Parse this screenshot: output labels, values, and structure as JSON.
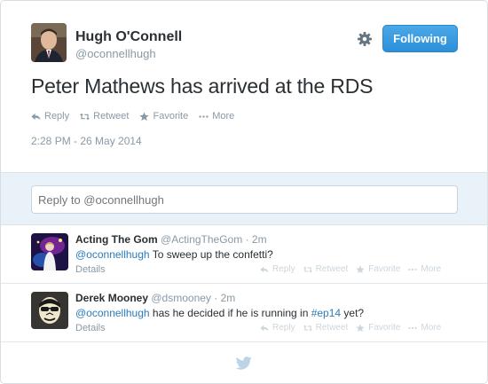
{
  "main_tweet": {
    "name": "Hugh O'Connell",
    "handle": "@oconnellhugh",
    "follow_label": "Following",
    "text": "Peter Mathews has arrived at the RDS",
    "actions": {
      "reply": "Reply",
      "retweet": "Retweet",
      "favorite": "Favorite",
      "more": "More"
    },
    "timestamp": "2:28 PM - 26 May 2014"
  },
  "reply_box": {
    "placeholder": "Reply to @oconnellhugh"
  },
  "replies": [
    {
      "name": "Acting The Gom",
      "handle": "@ActingTheGom",
      "time": "· 2m",
      "mention": "@oconnellhugh",
      "text": " To sweep up the confetti?",
      "details": "Details",
      "actions": {
        "reply": "Reply",
        "retweet": "Retweet",
        "favorite": "Favorite",
        "more": "More"
      }
    },
    {
      "name": "Derek Mooney",
      "handle": "@dsmooney",
      "time": "· 2m",
      "mention": "@oconnellhugh",
      "text_before": " has he decided if he is running in ",
      "hashtag": "#ep14",
      "text_after": " yet?",
      "details": "Details",
      "actions": {
        "reply": "Reply",
        "retweet": "Retweet",
        "favorite": "Favorite",
        "more": "More"
      }
    }
  ],
  "icons": [
    "gear-icon",
    "reply-icon",
    "retweet-icon",
    "favorite-icon",
    "more-icon",
    "twitter-bird-icon"
  ],
  "colors": {
    "link": "#2b7bb9",
    "follow_button": "#3399e6",
    "reply_area_bg": "#e9f2f9",
    "muted": "#8899a6"
  }
}
